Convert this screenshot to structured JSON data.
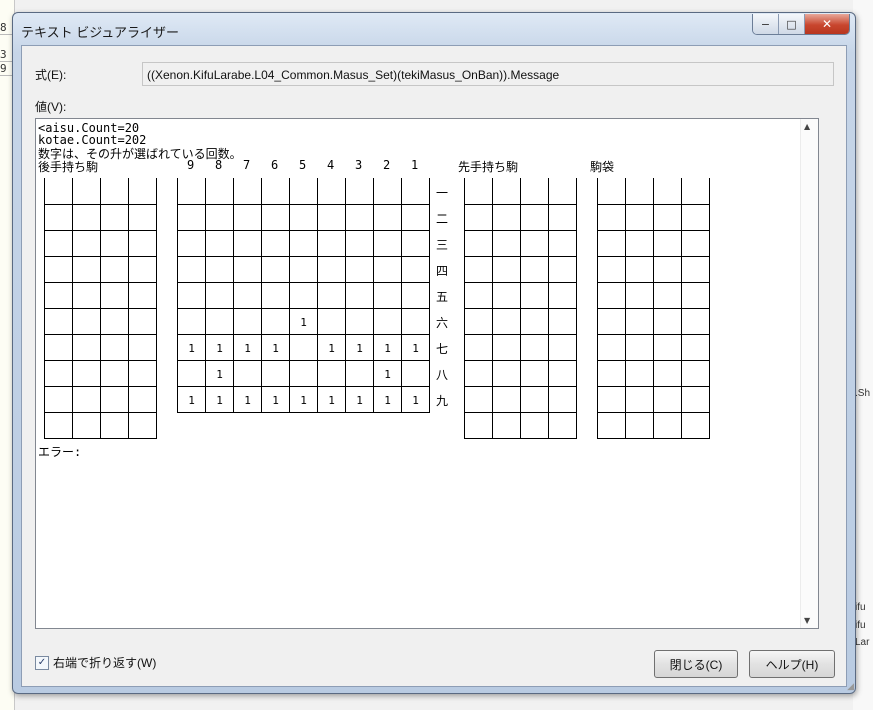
{
  "background": {
    "left_lines": [
      "8",
      "3",
      "9"
    ],
    "right_texts": [
      ".Sh",
      "ifu",
      "ifu",
      "Lar"
    ]
  },
  "dialog": {
    "title": "テキスト ビジュアライザー",
    "window_buttons": {
      "minimize": "−",
      "maximize": "□",
      "close": "✕"
    },
    "expression_label": "式(E):",
    "expression_value": "((Xenon.KifuLarabe.L04_Common.Masus_Set)(tekiMasus_OnBan)).Message",
    "value_label": "値(V):",
    "wrap_label": "右端で折り返す(W)",
    "wrap_checked": "✓",
    "close_button": "閉じる(C)",
    "help_button": "ヘルプ(H)"
  },
  "content": {
    "line1": "<aisu.Count=20",
    "line2": "kotae.Count=202",
    "line3": "数字は、その升が選ばれている回数。",
    "header_gote": "後手持ち駒",
    "header_sente": "先手持ち駒",
    "header_bag": "駒袋",
    "error_label": "エラー:",
    "column_numbers": [
      "9",
      "8",
      "7",
      "6",
      "5",
      "4",
      "3",
      "2",
      "1"
    ],
    "row_kanji": [
      "一",
      "二",
      "三",
      "四",
      "五",
      "六",
      "七",
      "八",
      "九"
    ],
    "board_rows": [
      [
        "",
        "",
        "",
        "",
        "",
        "",
        "",
        "",
        ""
      ],
      [
        "",
        "",
        "",
        "",
        "",
        "",
        "",
        "",
        ""
      ],
      [
        "",
        "",
        "",
        "",
        "",
        "",
        "",
        "",
        ""
      ],
      [
        "",
        "",
        "",
        "",
        "",
        "",
        "",
        "",
        ""
      ],
      [
        "",
        "",
        "",
        "",
        "",
        "",
        "",
        "",
        ""
      ],
      [
        "",
        "",
        "",
        "",
        "1",
        "",
        "",
        "",
        ""
      ],
      [
        "1",
        "1",
        "1",
        "1",
        "",
        "1",
        "1",
        "1",
        "1"
      ],
      [
        "",
        "1",
        "",
        "",
        "",
        "",
        "",
        "1",
        ""
      ],
      [
        "1",
        "1",
        "1",
        "1",
        "1",
        "1",
        "1",
        "1",
        "1"
      ]
    ]
  }
}
